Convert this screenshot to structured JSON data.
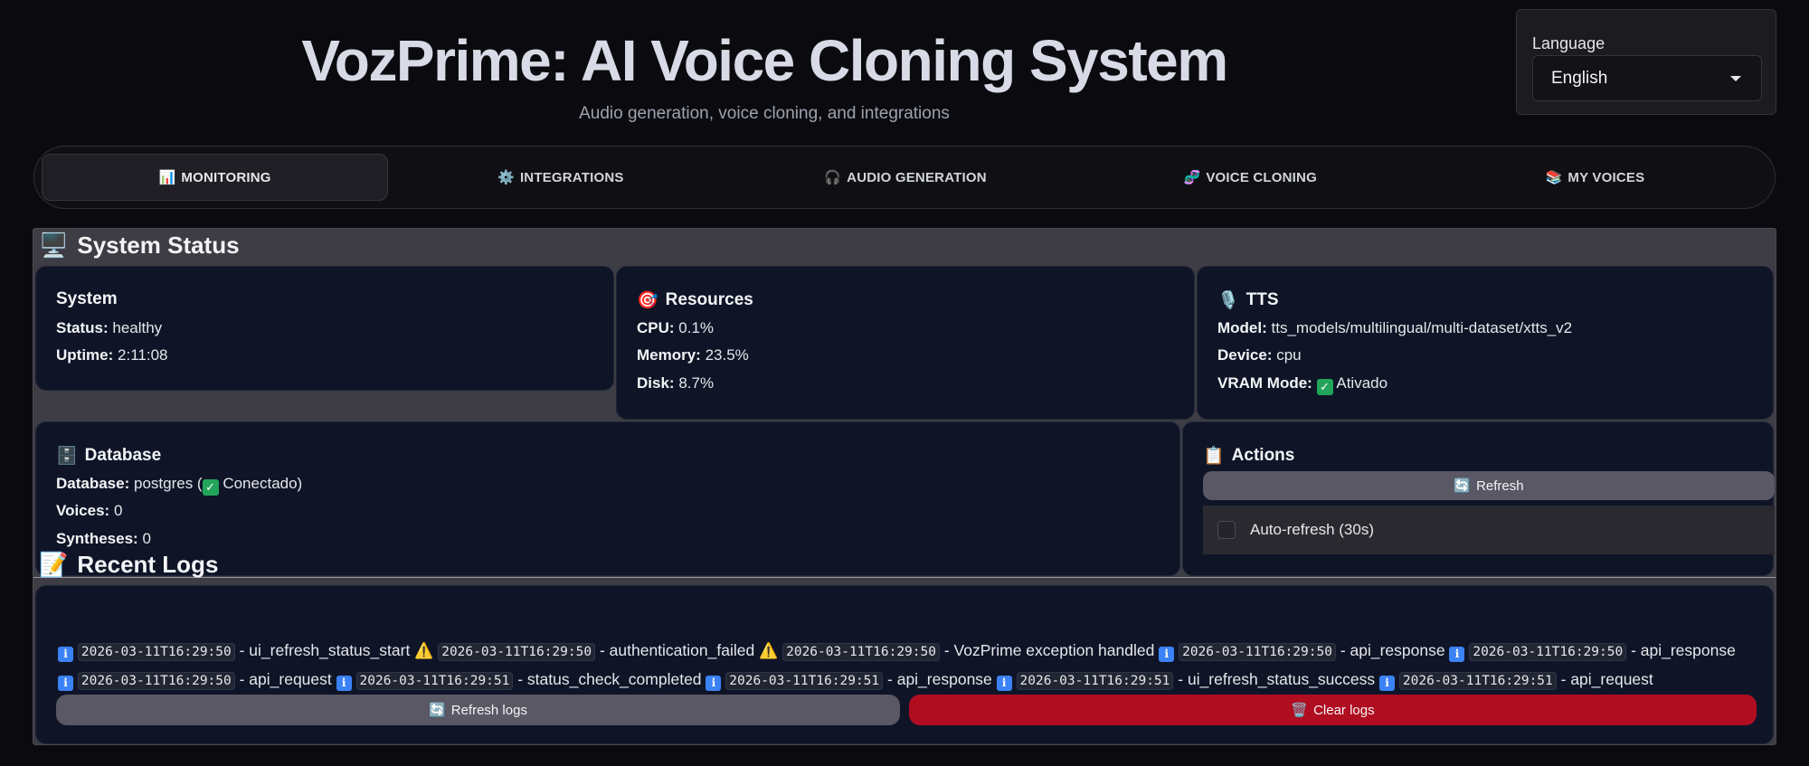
{
  "header": {
    "title": "VozPrime: AI Voice Cloning System",
    "subtitle": "Audio generation, voice cloning, and integrations"
  },
  "language": {
    "label": "Language",
    "selected": "English"
  },
  "tabs": [
    {
      "icon": "📊",
      "label": "MONITORING",
      "active": true
    },
    {
      "icon": "⚙️",
      "label": "INTEGRATIONS",
      "active": false
    },
    {
      "icon": "🎧",
      "label": "AUDIO GENERATION",
      "active": false
    },
    {
      "icon": "🧬",
      "label": "VOICE CLONING",
      "active": false
    },
    {
      "icon": "📚",
      "label": "MY VOICES",
      "active": false
    }
  ],
  "system_status": {
    "heading": "System Status",
    "system": {
      "title": "System",
      "status_label": "Status:",
      "status": "healthy",
      "uptime_label": "Uptime:",
      "uptime": "2:11:08"
    },
    "resources": {
      "title": "Resources",
      "cpu_label": "CPU:",
      "cpu": "0.1%",
      "memory_label": "Memory:",
      "memory": "23.5%",
      "disk_label": "Disk:",
      "disk": "8.7%"
    },
    "tts": {
      "title": "TTS",
      "model_label": "Model:",
      "model": "tts_models/multilingual/multi-dataset/xtts_v2",
      "device_label": "Device:",
      "device": "cpu",
      "vram_label": "VRAM Mode:",
      "vram": "Ativado"
    },
    "database": {
      "title": "Database",
      "db_label": "Database:",
      "db_name": "postgres (",
      "db_status": "Conectado)",
      "voices_label": "Voices:",
      "voices": "0",
      "syntheses_label": "Syntheses:",
      "syntheses": "0"
    },
    "actions": {
      "title": "Actions",
      "refresh_label": "Refresh",
      "auto_refresh_label": "Auto-refresh (30s)",
      "auto_refresh_checked": false
    }
  },
  "logs": {
    "heading": "Recent Logs",
    "entries": [
      {
        "level": "info",
        "ts": "2026-03-11T16:29:50",
        "msg": "ui_refresh_status_start"
      },
      {
        "level": "warn",
        "ts": "2026-03-11T16:29:50",
        "msg": "authentication_failed"
      },
      {
        "level": "warn",
        "ts": "2026-03-11T16:29:50",
        "msg": "VozPrime exception handled"
      },
      {
        "level": "info",
        "ts": "2026-03-11T16:29:50",
        "msg": "api_response"
      },
      {
        "level": "info",
        "ts": "2026-03-11T16:29:50",
        "msg": "api_response"
      },
      {
        "level": "info",
        "ts": "2026-03-11T16:29:50",
        "msg": "api_request"
      },
      {
        "level": "info",
        "ts": "2026-03-11T16:29:51",
        "msg": "status_check_completed"
      },
      {
        "level": "info",
        "ts": "2026-03-11T16:29:51",
        "msg": "api_response"
      },
      {
        "level": "info",
        "ts": "2026-03-11T16:29:51",
        "msg": "ui_refresh_status_success"
      },
      {
        "level": "info",
        "ts": "2026-03-11T16:29:51",
        "msg": "api_request"
      }
    ],
    "refresh_label": "Refresh logs",
    "clear_label": "Clear logs"
  },
  "colors": {
    "background": "#0b0b0f",
    "card": "#0f1527",
    "panel": "#3e3c44",
    "danger": "#b00d20",
    "success": "#22a55b",
    "info": "#3b82f6",
    "warning": "#f59e0b"
  }
}
